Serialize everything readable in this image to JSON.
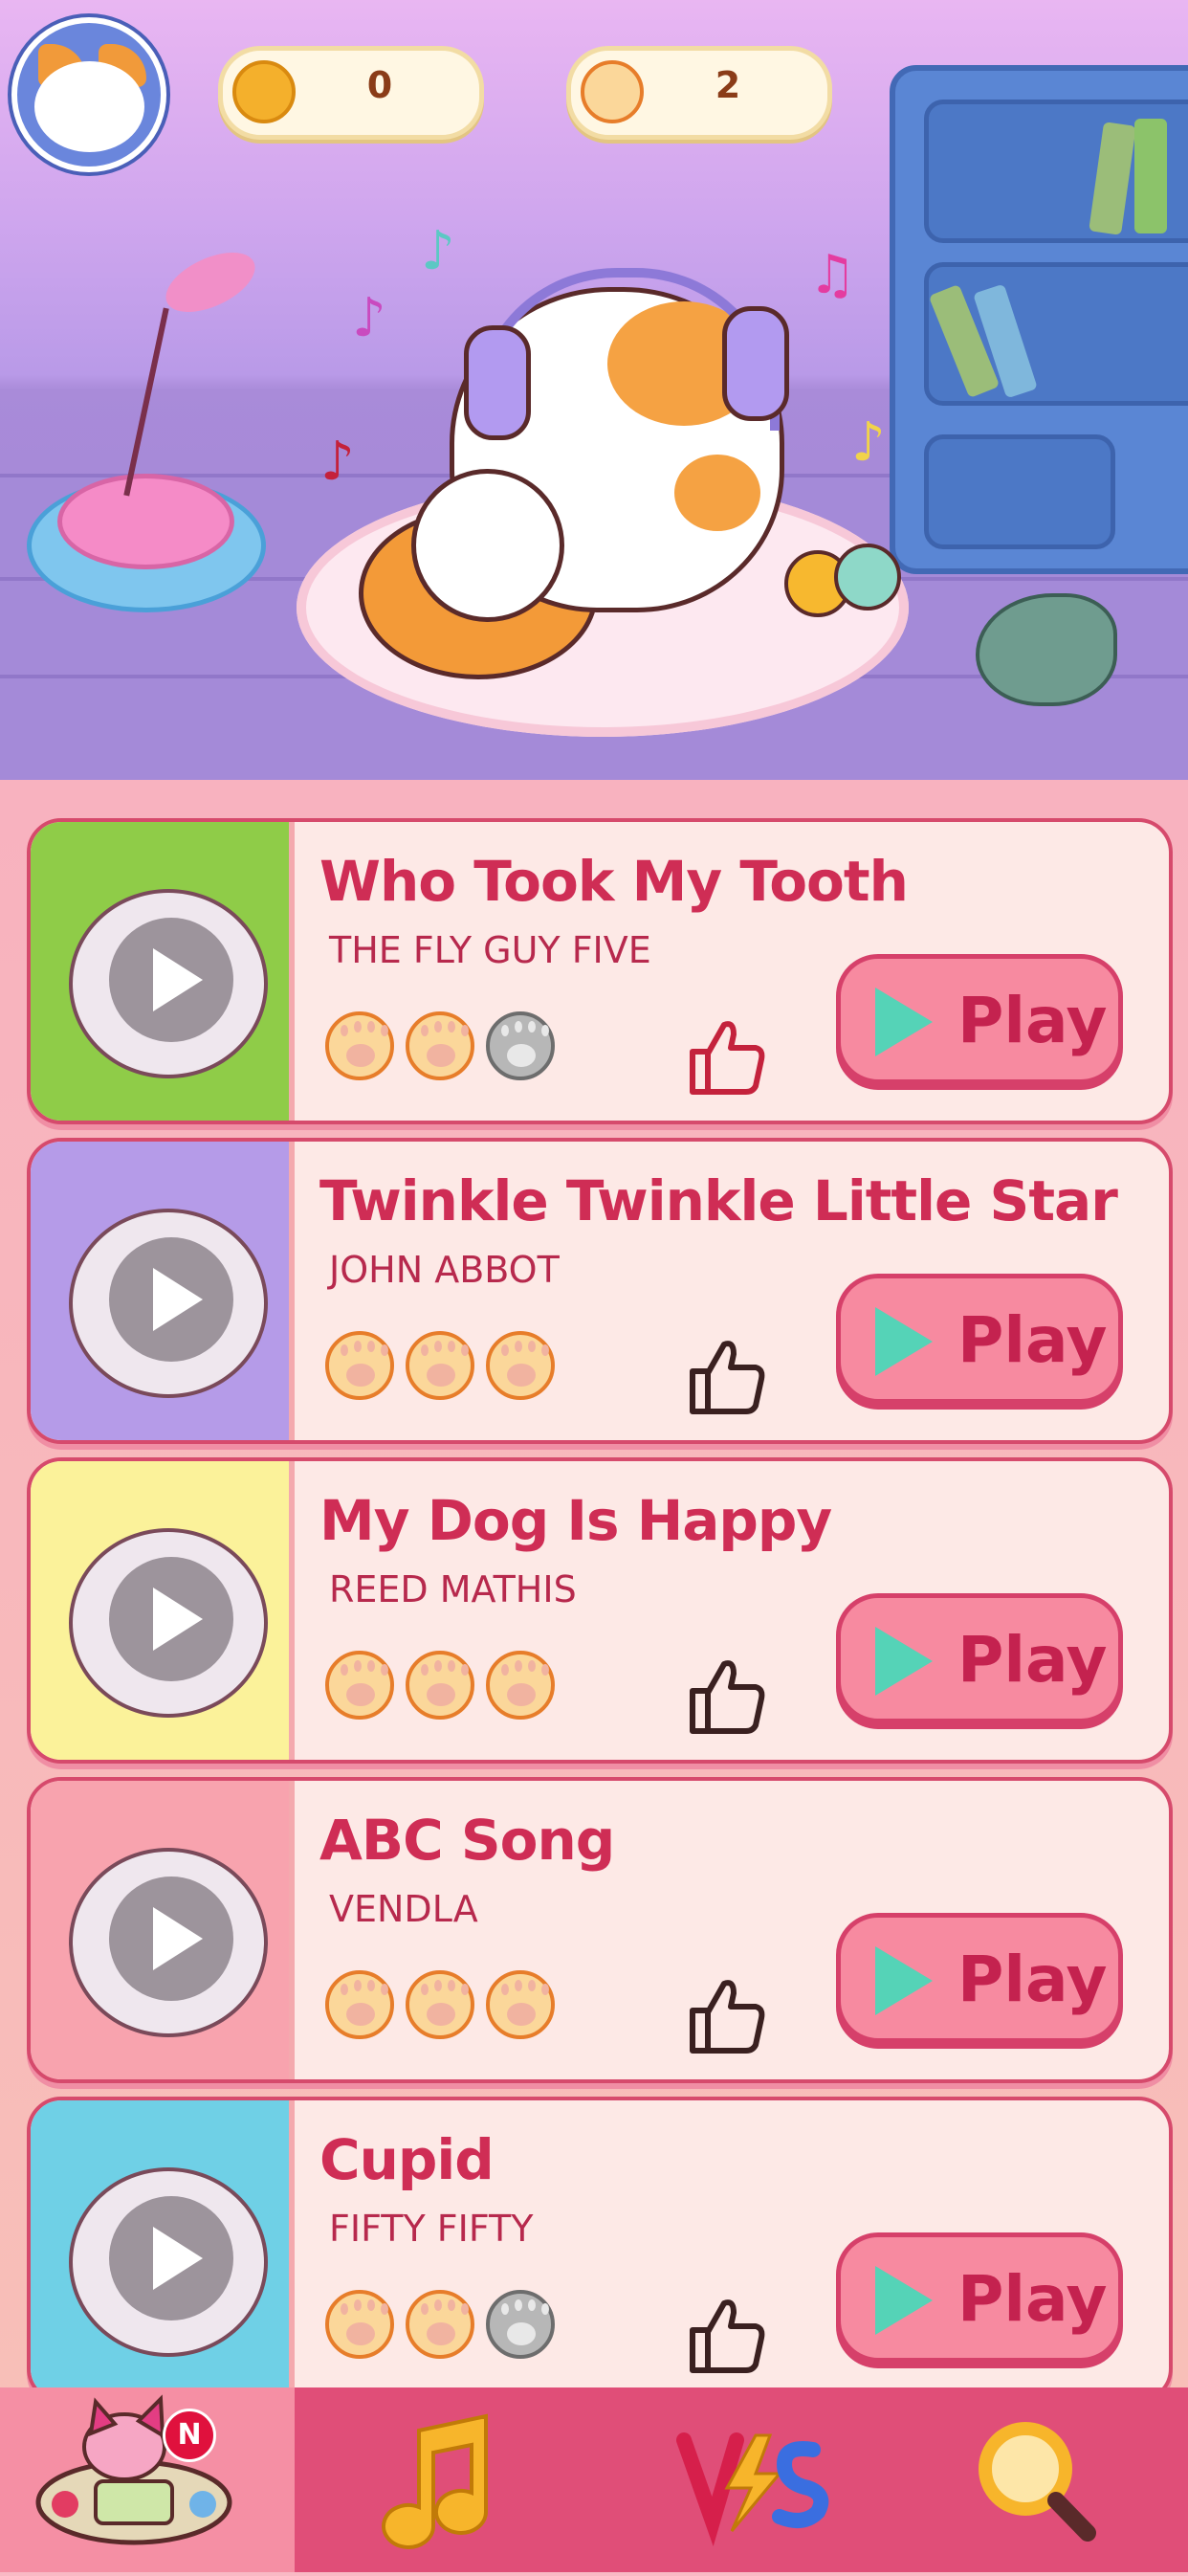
{
  "header": {
    "coins": "0",
    "paws": "2"
  },
  "songs": [
    {
      "title": "Who Took My Tooth",
      "artist": "THE FLY GUY FIVE",
      "stars": 2,
      "thumb_color": "#8fcc48",
      "liked": true
    },
    {
      "title": "Twinkle Twinkle Little Star",
      "artist": "JOHN ABBOT",
      "stars": 3,
      "thumb_color": "#b59be8",
      "liked": false
    },
    {
      "title": "My Dog Is Happy",
      "artist": "REED MATHIS",
      "stars": 3,
      "thumb_color": "#fbf29a",
      "liked": false
    },
    {
      "title": "ABC Song",
      "artist": "VENDLA",
      "stars": 3,
      "thumb_color": "#f8a3ae",
      "liked": false
    },
    {
      "title": "Cupid",
      "artist": "FIFTY FIFTY",
      "stars": 2,
      "thumb_color": "#6fd0e6",
      "liked": false
    }
  ],
  "play_label": "Play",
  "nav": {
    "badge": "N",
    "items": [
      "home-games",
      "music",
      "versus",
      "search"
    ]
  },
  "colors": {
    "accent": "#d64a6c",
    "nav_bg": "#e04e78",
    "play_icon": "#55d3b7"
  }
}
